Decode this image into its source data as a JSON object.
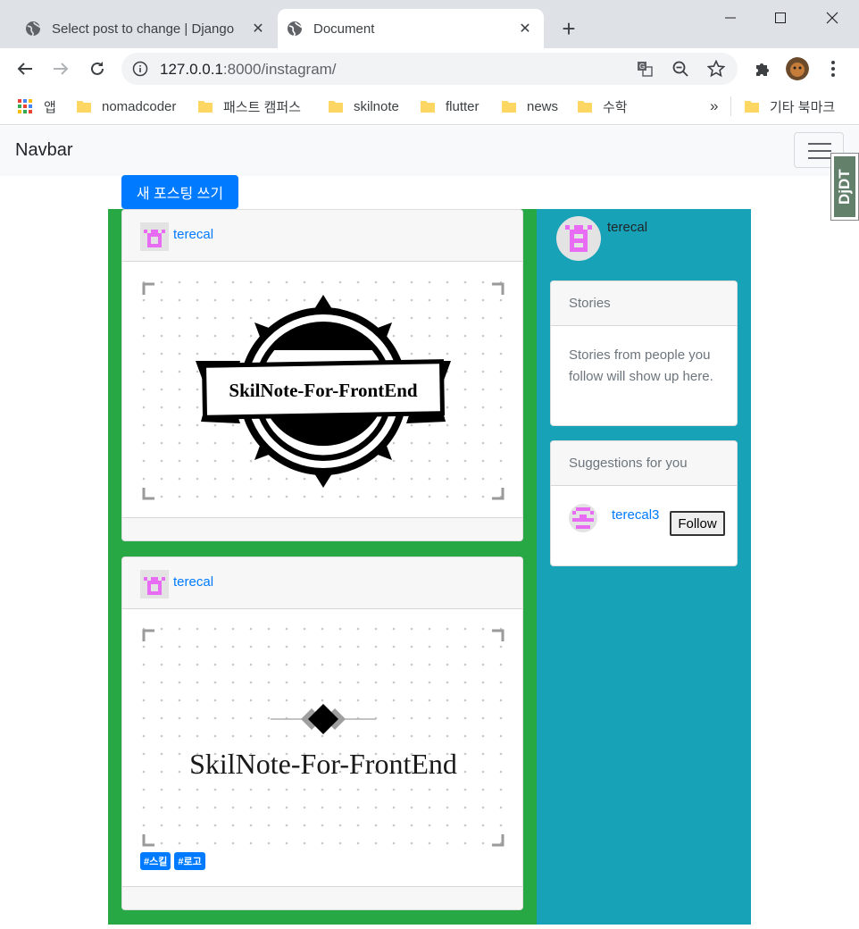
{
  "browser": {
    "tabs": [
      {
        "title": "Select post to change | Django",
        "active": false
      },
      {
        "title": "Document",
        "active": true
      }
    ],
    "new_tab": "+",
    "address": {
      "host": "127.0.0.1",
      "rest": ":8000/instagram/"
    },
    "bookmarks": {
      "apps": "앱",
      "items": [
        "nomadcoder",
        "패스트 캠퍼스",
        "skilnote",
        "flutter",
        "news",
        "수학"
      ],
      "overflow": "»",
      "other": "기타 북마크"
    }
  },
  "navbar": {
    "brand": "Navbar"
  },
  "ddt_label": "DjDT",
  "new_post_button": "새 포스팅 쓰기",
  "posts": [
    {
      "author": "terecal",
      "image_text": "SkilNote-For-FrontEnd",
      "tags": []
    },
    {
      "author": "terecal",
      "image_text": "SkilNote-For-FrontEnd",
      "tags": [
        "#스킬",
        "#로고"
      ]
    }
  ],
  "sidebar": {
    "profile_name": "terecal",
    "stories": {
      "title": "Stories",
      "text": "Stories from people you follow will show up here."
    },
    "suggestions": {
      "title": "Suggestions for you",
      "user": "terecal3",
      "follow_label": "Follow"
    }
  },
  "colors": {
    "primary": "#007bff",
    "green": "#28a745",
    "teal": "#17a2b8",
    "avatar_pink": "#e76bf3"
  }
}
